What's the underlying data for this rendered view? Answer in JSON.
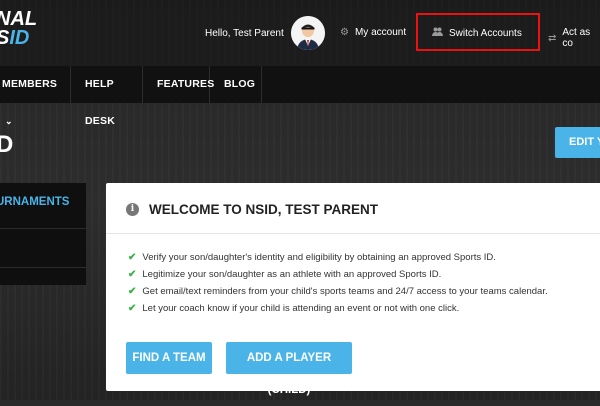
{
  "brand": {
    "line1": "NAL",
    "line2_prefix": "S",
    "line2_accent": "ID"
  },
  "header": {
    "greeting": "Hello, Test Parent",
    "my_account": "My account",
    "switch_accounts": "Switch Accounts",
    "act_as": "Act as co"
  },
  "menu": [
    "MEMBERS",
    "HELP DESK",
    "FEATURES",
    "BLOG"
  ],
  "page": {
    "title_fragment": "D",
    "edit_button": "EDIT YO"
  },
  "sidebar": {
    "item1": "URNAMENTS"
  },
  "welcome": {
    "title": "WELCOME TO NSID, TEST PARENT",
    "bullets": [
      "Verify your son/daughter's identity and eligibility by obtaining an approved Sports ID.",
      "Legitimize your son/daughter as an athlete with an approved Sports ID.",
      "Get email/text reminders from your child's sports teams and 24/7 access to your teams calendar.",
      "Let your coach know if your child is attending an event or not with one click."
    ],
    "find_team": "FIND A TEAM",
    "add_player": "ADD A PLAYER (CHILD)"
  },
  "colors": {
    "accent": "#4ab3e8",
    "highlight": "#e11111",
    "check": "#3bb34a"
  },
  "icons": {
    "my_account": "gear-icon",
    "switch_accounts": "users-icon",
    "act_as": "exchange-icon",
    "info": "info-icon",
    "check": "check-icon"
  }
}
